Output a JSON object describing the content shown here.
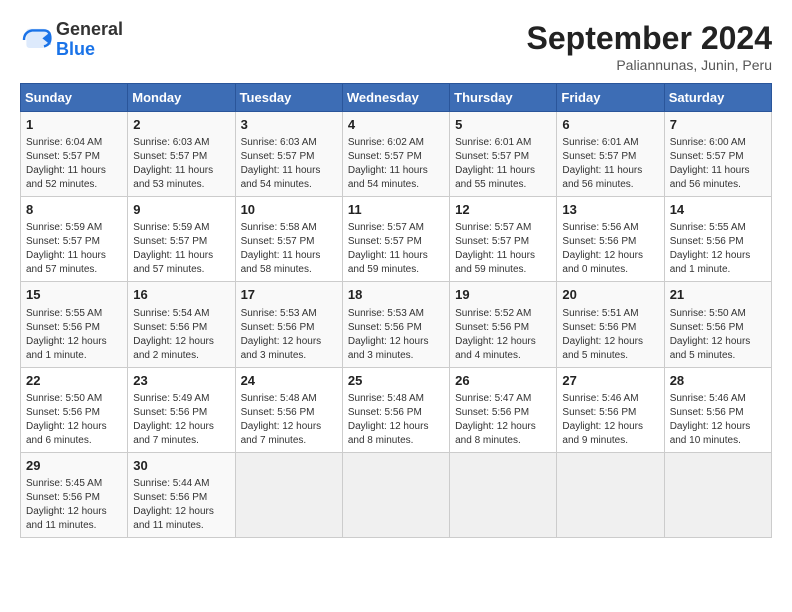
{
  "header": {
    "logo_line1": "General",
    "logo_line2": "Blue",
    "title": "September 2024",
    "subtitle": "Paliannunas, Junin, Peru"
  },
  "days_of_week": [
    "Sunday",
    "Monday",
    "Tuesday",
    "Wednesday",
    "Thursday",
    "Friday",
    "Saturday"
  ],
  "weeks": [
    [
      {
        "num": "1",
        "sunrise": "6:04 AM",
        "sunset": "5:57 PM",
        "daylight": "11 hours and 52 minutes."
      },
      {
        "num": "2",
        "sunrise": "6:03 AM",
        "sunset": "5:57 PM",
        "daylight": "11 hours and 53 minutes."
      },
      {
        "num": "3",
        "sunrise": "6:03 AM",
        "sunset": "5:57 PM",
        "daylight": "11 hours and 54 minutes."
      },
      {
        "num": "4",
        "sunrise": "6:02 AM",
        "sunset": "5:57 PM",
        "daylight": "11 hours and 54 minutes."
      },
      {
        "num": "5",
        "sunrise": "6:01 AM",
        "sunset": "5:57 PM",
        "daylight": "11 hours and 55 minutes."
      },
      {
        "num": "6",
        "sunrise": "6:01 AM",
        "sunset": "5:57 PM",
        "daylight": "11 hours and 56 minutes."
      },
      {
        "num": "7",
        "sunrise": "6:00 AM",
        "sunset": "5:57 PM",
        "daylight": "11 hours and 56 minutes."
      }
    ],
    [
      {
        "num": "8",
        "sunrise": "5:59 AM",
        "sunset": "5:57 PM",
        "daylight": "11 hours and 57 minutes."
      },
      {
        "num": "9",
        "sunrise": "5:59 AM",
        "sunset": "5:57 PM",
        "daylight": "11 hours and 57 minutes."
      },
      {
        "num": "10",
        "sunrise": "5:58 AM",
        "sunset": "5:57 PM",
        "daylight": "11 hours and 58 minutes."
      },
      {
        "num": "11",
        "sunrise": "5:57 AM",
        "sunset": "5:57 PM",
        "daylight": "11 hours and 59 minutes."
      },
      {
        "num": "12",
        "sunrise": "5:57 AM",
        "sunset": "5:57 PM",
        "daylight": "11 hours and 59 minutes."
      },
      {
        "num": "13",
        "sunrise": "5:56 AM",
        "sunset": "5:56 PM",
        "daylight": "12 hours and 0 minutes."
      },
      {
        "num": "14",
        "sunrise": "5:55 AM",
        "sunset": "5:56 PM",
        "daylight": "12 hours and 1 minute."
      }
    ],
    [
      {
        "num": "15",
        "sunrise": "5:55 AM",
        "sunset": "5:56 PM",
        "daylight": "12 hours and 1 minute."
      },
      {
        "num": "16",
        "sunrise": "5:54 AM",
        "sunset": "5:56 PM",
        "daylight": "12 hours and 2 minutes."
      },
      {
        "num": "17",
        "sunrise": "5:53 AM",
        "sunset": "5:56 PM",
        "daylight": "12 hours and 3 minutes."
      },
      {
        "num": "18",
        "sunrise": "5:53 AM",
        "sunset": "5:56 PM",
        "daylight": "12 hours and 3 minutes."
      },
      {
        "num": "19",
        "sunrise": "5:52 AM",
        "sunset": "5:56 PM",
        "daylight": "12 hours and 4 minutes."
      },
      {
        "num": "20",
        "sunrise": "5:51 AM",
        "sunset": "5:56 PM",
        "daylight": "12 hours and 5 minutes."
      },
      {
        "num": "21",
        "sunrise": "5:50 AM",
        "sunset": "5:56 PM",
        "daylight": "12 hours and 5 minutes."
      }
    ],
    [
      {
        "num": "22",
        "sunrise": "5:50 AM",
        "sunset": "5:56 PM",
        "daylight": "12 hours and 6 minutes."
      },
      {
        "num": "23",
        "sunrise": "5:49 AM",
        "sunset": "5:56 PM",
        "daylight": "12 hours and 7 minutes."
      },
      {
        "num": "24",
        "sunrise": "5:48 AM",
        "sunset": "5:56 PM",
        "daylight": "12 hours and 7 minutes."
      },
      {
        "num": "25",
        "sunrise": "5:48 AM",
        "sunset": "5:56 PM",
        "daylight": "12 hours and 8 minutes."
      },
      {
        "num": "26",
        "sunrise": "5:47 AM",
        "sunset": "5:56 PM",
        "daylight": "12 hours and 8 minutes."
      },
      {
        "num": "27",
        "sunrise": "5:46 AM",
        "sunset": "5:56 PM",
        "daylight": "12 hours and 9 minutes."
      },
      {
        "num": "28",
        "sunrise": "5:46 AM",
        "sunset": "5:56 PM",
        "daylight": "12 hours and 10 minutes."
      }
    ],
    [
      {
        "num": "29",
        "sunrise": "5:45 AM",
        "sunset": "5:56 PM",
        "daylight": "12 hours and 11 minutes."
      },
      {
        "num": "30",
        "sunrise": "5:44 AM",
        "sunset": "5:56 PM",
        "daylight": "12 hours and 11 minutes."
      },
      null,
      null,
      null,
      null,
      null
    ]
  ]
}
